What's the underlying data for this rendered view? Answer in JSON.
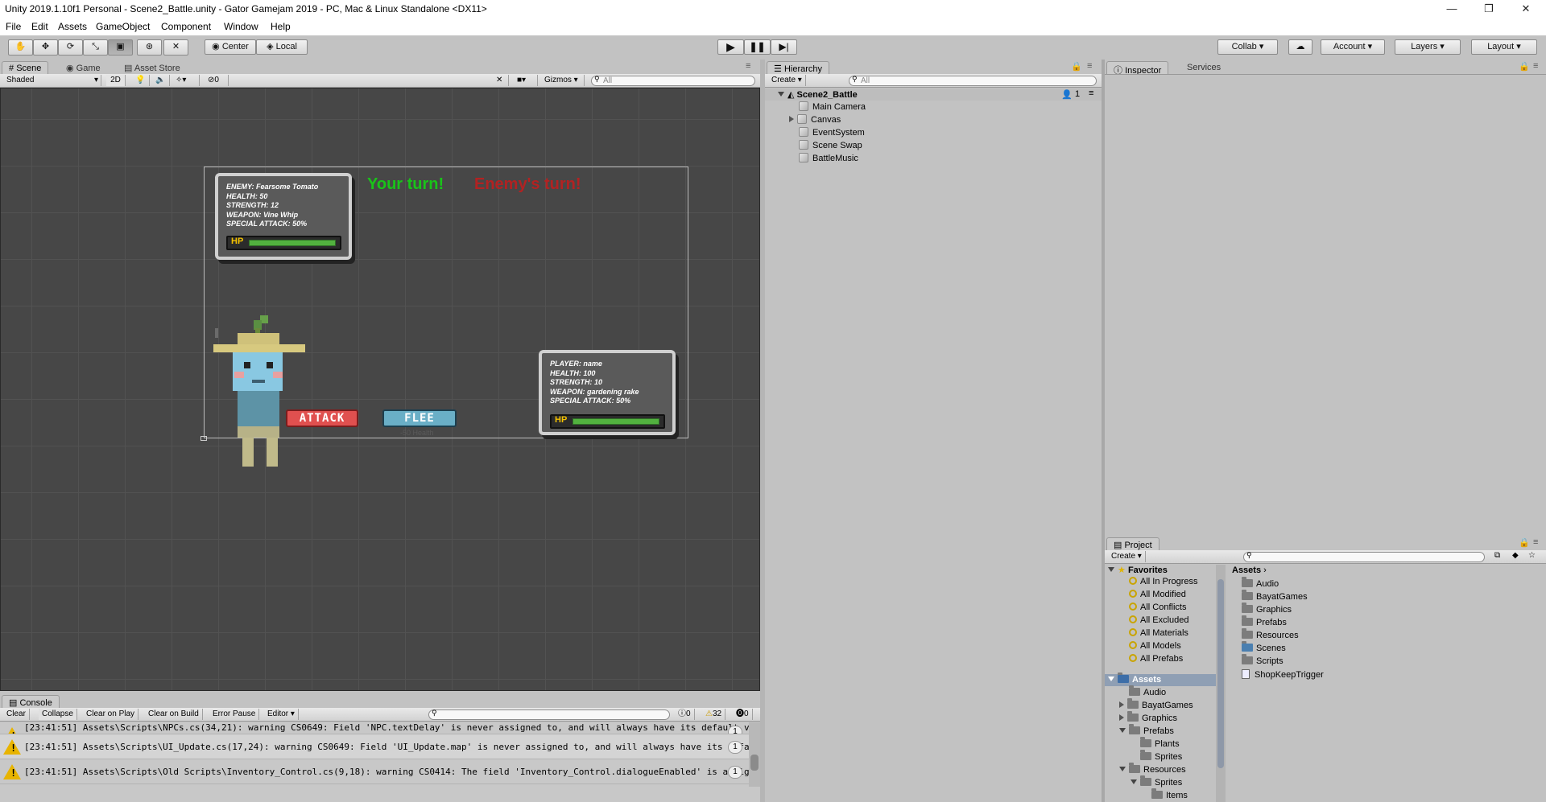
{
  "window": {
    "title": "Unity 2019.1.10f1 Personal - Scene2_Battle.unity - Gator Gamejam 2019 - PC, Mac & Linux Standalone <DX11>",
    "minimize": "—",
    "maximize": "❐",
    "close": "✕"
  },
  "menu": [
    "File",
    "Edit",
    "Assets",
    "GameObject",
    "Component",
    "Window",
    "Help"
  ],
  "toolbar": {
    "pivot": "Center",
    "space": "Local",
    "collab": "Collab ▾",
    "account": "Account",
    "layers": "Layers",
    "layout": "Layout"
  },
  "scene_tabs": {
    "scene": "Scene",
    "game": "Game",
    "asset_store": "Asset Store"
  },
  "scene_toolbar": {
    "shading": "Shaded",
    "mode_2d": "2D",
    "hidden_count": "0",
    "gizmos": "Gizmos",
    "search_placeholder": "All"
  },
  "game_view": {
    "your_turn": "Your turn!",
    "enemy_turn": "Enemy's turn!",
    "enemy_info": [
      "ENEMY: Fearsome Tomato",
      "HEALTH: 50",
      "STRENGTH: 12",
      "WEAPON: Vine Whip",
      "SPECIAL ATTACK: 50%"
    ],
    "player_info": [
      "PLAYER: name",
      "HEALTH: 100",
      "STRENGTH: 10",
      "WEAPON: gardening rake",
      "SPECIAL ATTACK: 50%"
    ],
    "hp_label": "HP",
    "attack_button": "ATTACK",
    "flee_button": "FLEE",
    "flee_sub": "-50 Health"
  },
  "hierarchy": {
    "tab": "Hierarchy",
    "create": "Create",
    "search_placeholder": "All",
    "scene_name": "Scene2_Battle",
    "user_count": "1",
    "items": [
      "Main Camera",
      "Canvas",
      "EventSystem",
      "Scene Swap",
      "BattleMusic"
    ]
  },
  "inspector": {
    "tab": "Inspector",
    "services_tab": "Services"
  },
  "project": {
    "tab": "Project",
    "create": "Create",
    "favorites_label": "Favorites",
    "favorites": [
      "All In Progress",
      "All Modified",
      "All Conflicts",
      "All Excluded",
      "All Materials",
      "All Models",
      "All Prefabs"
    ],
    "assets_label": "Assets",
    "tree": [
      "Audio",
      "BayatGames",
      "Graphics",
      "Prefabs",
      "Plants",
      "Sprites",
      "Resources",
      "Sprites",
      "Items"
    ],
    "breadcrumb": "Assets",
    "contents": [
      "Audio",
      "BayatGames",
      "Graphics",
      "Prefabs",
      "Resources",
      "Scenes",
      "Scripts",
      "ShopKeepTrigger"
    ]
  },
  "console": {
    "tab": "Console",
    "buttons": [
      "Clear",
      "Collapse",
      "Clear on Play",
      "Clear on Build",
      "Error Pause",
      "Editor"
    ],
    "info_count": "0",
    "warning_count": "32",
    "error_count": "0",
    "rows": [
      {
        "text": "[23:41:51] Assets\\Scripts\\NPCs.cs(34,21): warning CS0649: Field 'NPC.textDelay' is never assigned to, and will always have its default value false",
        "count": "1"
      },
      {
        "text": "[23:41:51] Assets\\Scripts\\UI_Update.cs(17,24): warning CS0649: Field 'UI_Update.map' is never assigned to, and will always have its default value null",
        "count": "1"
      },
      {
        "text": "[23:41:51] Assets\\Scripts\\Old Scripts\\Inventory_Control.cs(9,18): warning CS0414: The field 'Inventory_Control.dialogueEnabled' is assigned but its value is never used",
        "count": "1"
      }
    ]
  },
  "colors": {
    "your_turn": "#19c419",
    "enemy_turn": "#b22222",
    "attack_bg": "#e0504f",
    "flee_bg": "#6aafc7"
  }
}
